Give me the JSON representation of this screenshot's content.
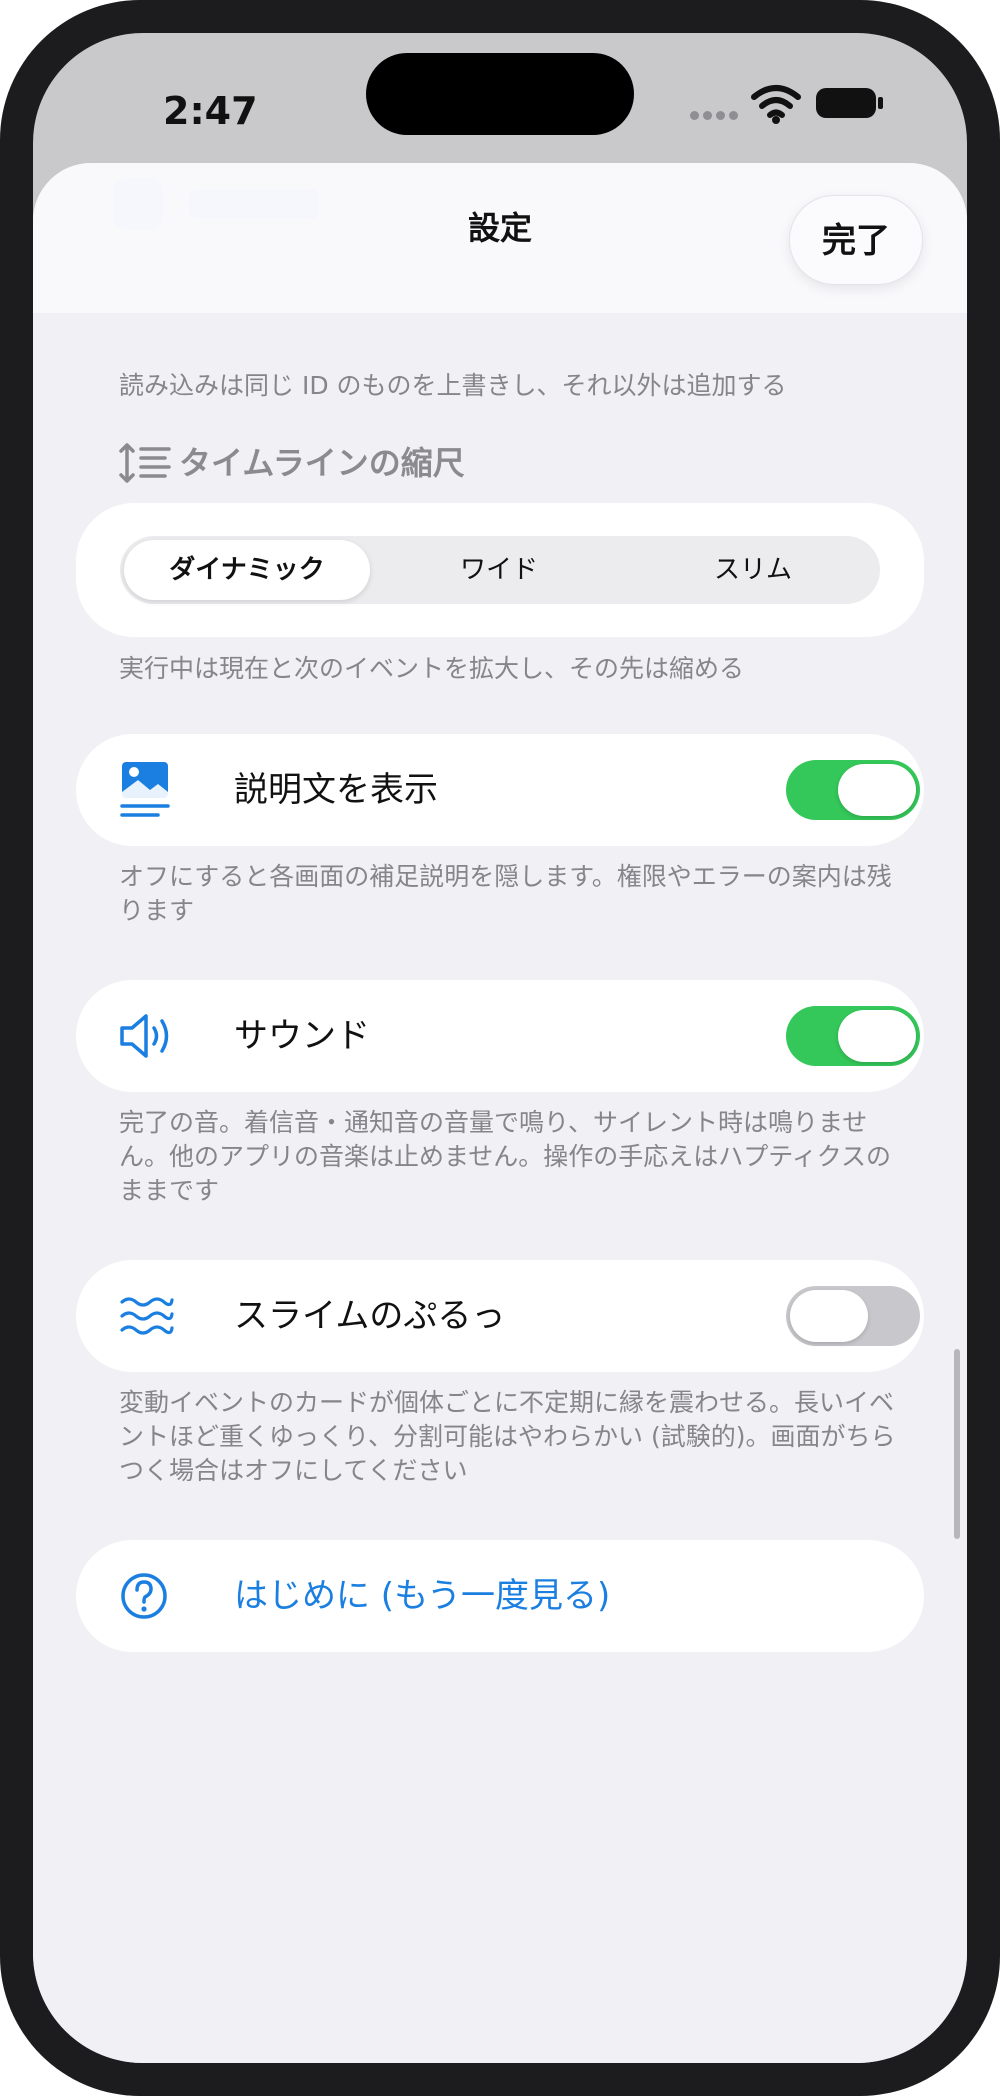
{
  "status_bar": {
    "time": "2:47"
  },
  "sheet": {
    "title": "設定",
    "done_label": "完了",
    "backup_description": "読み込みは同じ ID のものを上書きし、それ以外は追加する",
    "timeline_scale": {
      "header": "タイムラインの縮尺",
      "options": [
        "ダイナミック",
        "ワイド",
        "スリム"
      ],
      "selected": "ダイナミック",
      "description": "実行中は現在と次のイベントを拡大し、その先は縮める"
    },
    "show_description": {
      "label": "説明文を表示",
      "on": true,
      "description": "オフにすると各画面の補足説明を隠します。権限やエラーの案内は残ります"
    },
    "sound": {
      "label": "サウンド",
      "on": true,
      "description": "完了の音。着信音・通知音の音量で鳴り、サイレント時は鳴りません。他のアプリの音楽は止めません。操作の手応えはハプティクスのままです"
    },
    "slime_wobble": {
      "label": "スライムのぷるっ",
      "on": false,
      "description": "変動イベントのカードが個体ごとに不定期に縁を震わせる。長いイベントほど重くゆっくり、分割可能はやわらかい (試験的)。画面がちらつく場合はオフにしてください"
    },
    "intro": {
      "label": "はじめに (もう一度見る)"
    }
  },
  "colors": {
    "accent": "#1a7fe0",
    "toggle_on": "#34c759",
    "toggle_off": "#c7c7cc",
    "background": "#f0f0f5"
  }
}
